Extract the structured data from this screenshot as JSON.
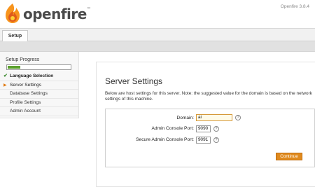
{
  "header": {
    "brand": "openfire",
    "trademark": "™",
    "version": "Openfire 3.8.4",
    "logo_icon": "openfire-flame-logo",
    "logo_colors": [
      "#f7941d",
      "#e05a1c",
      "#fbd034"
    ]
  },
  "tabs": [
    {
      "label": "Setup"
    }
  ],
  "sidebar": {
    "title": "Setup Progress",
    "progress": 0.2,
    "progress_color": "#5aa02c",
    "steps": [
      {
        "label": "Language Selection",
        "state": "done",
        "icon": "check-icon"
      },
      {
        "label": "Server Settings",
        "state": "current",
        "icon": "arrow-right-icon"
      },
      {
        "label": "Database Settings",
        "state": "pending"
      },
      {
        "label": "Profile Settings",
        "state": "pending"
      },
      {
        "label": "Admin Account",
        "state": "pending"
      }
    ]
  },
  "main": {
    "title": "Server Settings",
    "description": "Below are host settings for this server. Note: the suggested value for the domain is based on the network settings of this machine.",
    "fields": [
      {
        "label": "Domain:",
        "value": "ai"
      },
      {
        "label": "Admin Console Port:",
        "value": "9090"
      },
      {
        "label": "Secure Admin Console Port:",
        "value": "9091"
      }
    ],
    "help_glyph": "?",
    "continue_label": "Continue",
    "accent_color": "#e08a1e"
  }
}
